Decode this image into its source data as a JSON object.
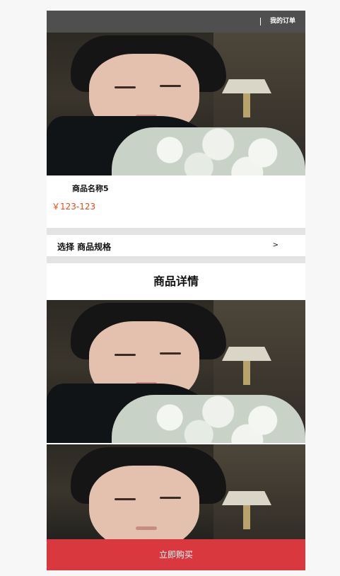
{
  "header": {
    "orders_label": "我的订单"
  },
  "product": {
    "name": "商品名称5",
    "price": "￥123-123"
  },
  "spec": {
    "label": "选择 商品规格",
    "arrow": ">"
  },
  "details": {
    "title": "商品详情"
  },
  "footer": {
    "buy_label": "立即购买"
  },
  "colors": {
    "topbar": "#4f4f4f",
    "price": "#e8491d",
    "buy_button": "#d9383e",
    "divider_band": "#e3e3e3"
  }
}
